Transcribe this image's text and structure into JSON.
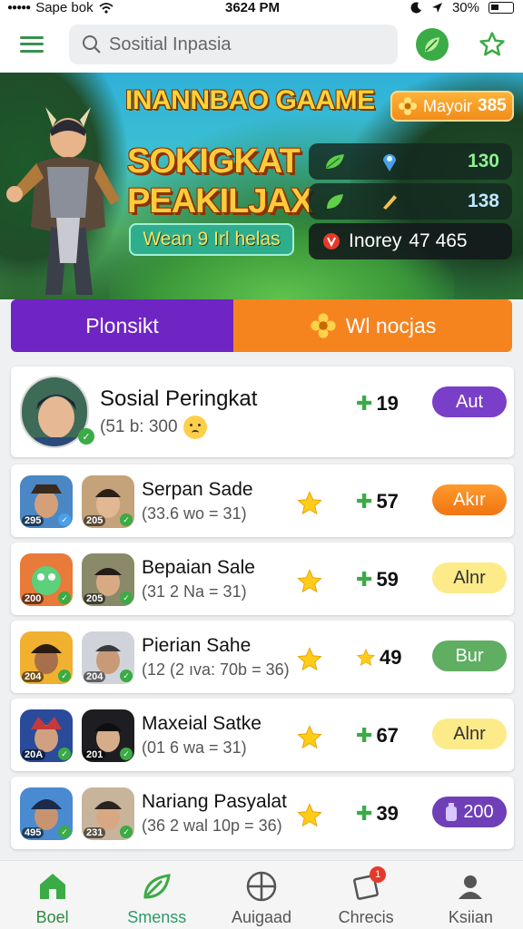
{
  "status_bar": {
    "carrier": "Sape bok",
    "time": "3624 PM",
    "battery": "30%"
  },
  "top_bar": {
    "search_placeholder": "Sositial Inpasia"
  },
  "banner": {
    "game_title": "INANNBAO GAAME",
    "headline_line1": "SOKIGKAT",
    "headline_line2": "PEAKILJAX",
    "cta_label": "Wean 9 Irl helas",
    "badge": {
      "label": "Mayoir",
      "value": "385"
    },
    "stats": [
      {
        "icon": "leaf-icon",
        "value": "130"
      },
      {
        "icon": "pin-icon",
        "value": "138"
      }
    ],
    "money": {
      "label": "Inorey",
      "value": "47 465"
    }
  },
  "tabs": {
    "left": "Plonsikt",
    "right": "Wl nocjas"
  },
  "leaderboard": {
    "featured": {
      "name": "Sosial  Peringkat",
      "sub": "(51 b: 300",
      "score": "19",
      "action": "Aut"
    },
    "rows": [
      {
        "name": "Serpan Sade",
        "sub": "(33.6 wo = 31)",
        "score": "57",
        "score_icon": "plus",
        "action": "Akır",
        "lvl_a": "295",
        "lvl_b": "205"
      },
      {
        "name": "Bepaian Sale",
        "sub": "(31 2 Na = 31)",
        "score": "59",
        "score_icon": "plus",
        "action": "Alnr",
        "lvl_a": "200",
        "lvl_b": "205"
      },
      {
        "name": "Pierian Sahe",
        "sub": "(12 (2 ıva: 70b = 36)",
        "score": "49",
        "score_icon": "star",
        "action": "Bur",
        "lvl_a": "204",
        "lvl_b": "204"
      },
      {
        "name": "Maxeial Satke",
        "sub": "(01 6 wa = 31)",
        "score": "67",
        "score_icon": "plus",
        "action": "Alnr",
        "lvl_a": "20A",
        "lvl_b": "201"
      },
      {
        "name": "Nariang Pasyalat",
        "sub": "(36 2 wal 10p = 36)",
        "score": "39",
        "score_icon": "plus",
        "action": "200",
        "lvl_a": "495",
        "lvl_b": "231"
      }
    ]
  },
  "bottom_nav": [
    {
      "label": "Boel",
      "icon": "home-icon",
      "color": "#2e8b3e"
    },
    {
      "label": "Smenss",
      "icon": "leaf-icon",
      "color": "#2e9a6a"
    },
    {
      "label": "Auigaad",
      "icon": "crosshair-icon",
      "color": "#555555"
    },
    {
      "label": "Chrecis",
      "icon": "card-icon",
      "color": "#555555",
      "badge": "1"
    },
    {
      "label": "Ksiian",
      "icon": "profile-icon",
      "color": "#555555"
    }
  ],
  "colors": {
    "accent_green": "#3bab45",
    "tab_purple": "#6f24c4",
    "tab_orange": "#f5841f"
  }
}
